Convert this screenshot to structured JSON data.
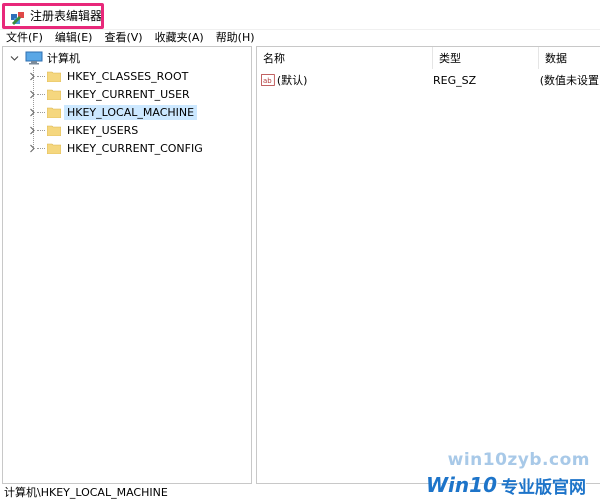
{
  "window": {
    "title": "注册表编辑器",
    "icon": "registry-editor-icon"
  },
  "menu": {
    "items": [
      {
        "label": "文件(F)"
      },
      {
        "label": "编辑(E)"
      },
      {
        "label": "查看(V)"
      },
      {
        "label": "收藏夹(A)"
      },
      {
        "label": "帮助(H)"
      }
    ]
  },
  "tree": {
    "root": {
      "label": "计算机",
      "icon": "computer-icon",
      "expanded": true
    },
    "items": [
      {
        "label": "HKEY_CLASSES_ROOT",
        "selected": false
      },
      {
        "label": "HKEY_CURRENT_USER",
        "selected": false
      },
      {
        "label": "HKEY_LOCAL_MACHINE",
        "selected": true
      },
      {
        "label": "HKEY_USERS",
        "selected": false
      },
      {
        "label": "HKEY_CURRENT_CONFIG",
        "selected": false
      }
    ]
  },
  "values": {
    "columns": [
      {
        "label": "名称"
      },
      {
        "label": "类型"
      },
      {
        "label": "数据"
      }
    ],
    "rows": [
      {
        "name": "(默认)",
        "type": "REG_SZ",
        "data": "(数值未设置)",
        "icon": "string-value-icon"
      }
    ]
  },
  "status": {
    "path": "计算机\\HKEY_LOCAL_MACHINE"
  },
  "watermark": {
    "url": "win10zyb.com",
    "brand": "Win10",
    "brand_cn": "专业版官网"
  },
  "colors": {
    "title_highlight": "#e8287a",
    "selection": "#cce8ff",
    "folder": "#f5d77f"
  }
}
